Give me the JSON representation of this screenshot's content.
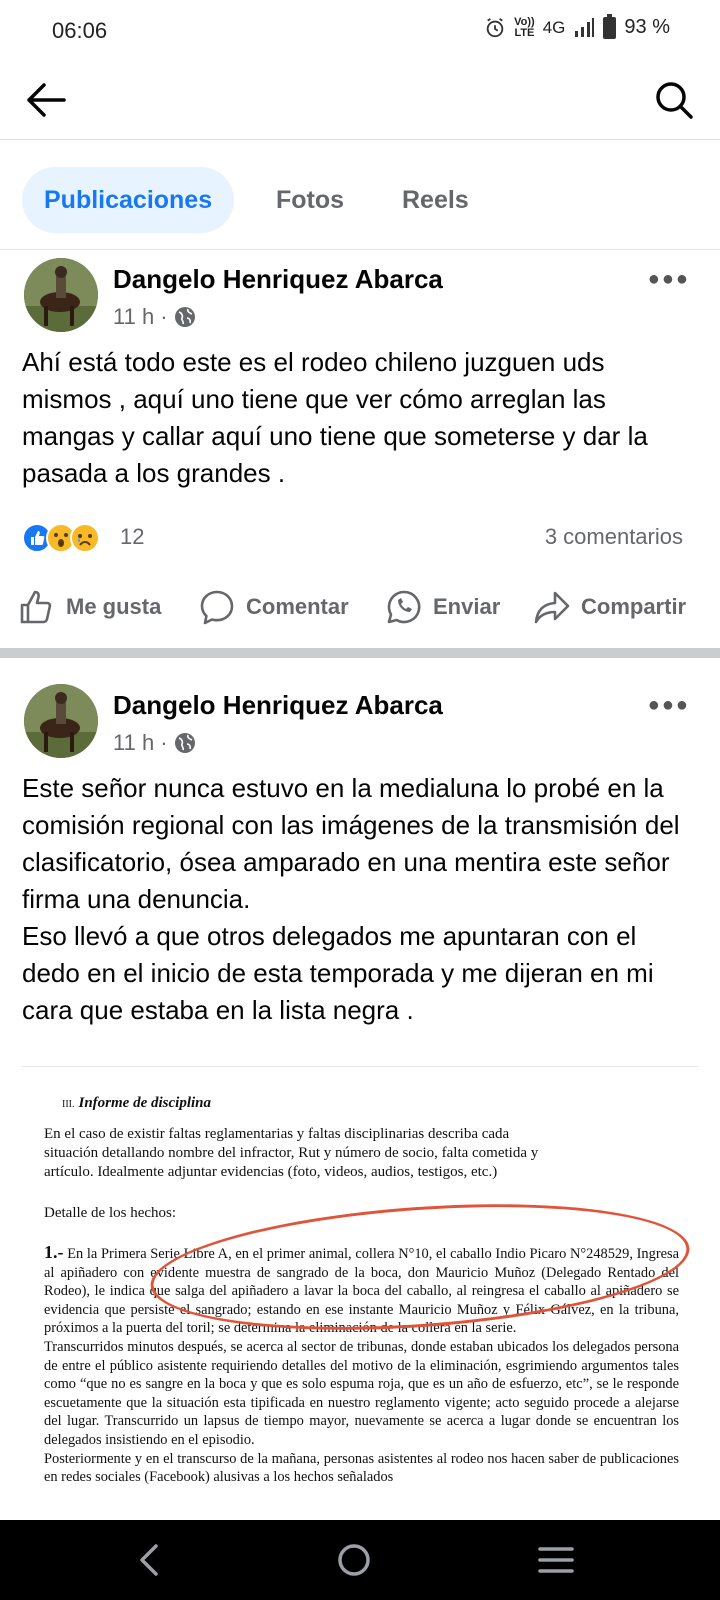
{
  "status_bar": {
    "time": "06:06",
    "network_label_top": "Vo))",
    "network_label_bottom": "LTE",
    "network_type": "4G",
    "battery": "93 %"
  },
  "app_bar": {
    "back_icon": "arrow-left-icon",
    "search_icon": "search-icon"
  },
  "tabs": [
    {
      "label": "Publicaciones",
      "active": true
    },
    {
      "label": "Fotos",
      "active": false
    },
    {
      "label": "Reels",
      "active": false
    }
  ],
  "posts": [
    {
      "author": "Dangelo Henriquez Abarca",
      "time": "11 h",
      "privacy_separator": "·",
      "text": "Ahí está todo este es el rodeo chileno juzguen uds mismos , aquí uno tiene que ver cómo arreglan las mangas y callar aquí uno tiene que someterse y dar la pasada a los grandes .",
      "reaction_count": "12",
      "comments": "3 comentarios"
    },
    {
      "author": "Dangelo Henriquez Abarca",
      "time": "11 h",
      "privacy_separator": "·",
      "text": "Este señor nunca estuvo en la medialuna lo probé en la comisión regional con las imágenes de la transmisión del clasificatorio, ósea amparado en una mentira este señor firma una denuncia.\nEso llevó a que otros delegados me apuntaran con el dedo en el inicio de esta temporada y me dijeran en mi cara que estaba en la lista negra ."
    }
  ],
  "actions": {
    "like": "Me gusta",
    "comment": "Comentar",
    "send": "Enviar",
    "share": "Compartir"
  },
  "document": {
    "section_number": "III.",
    "section_title": "Informe de disciplina",
    "intro": "En el caso de existir faltas reglamentarias y faltas disciplinarias describa cada situación detallando nombre del infractor, Rut y número de socio, falta cometida y artículo. Idealmente adjuntar evidencias (foto, videos, audios, testigos, etc.)",
    "detail_heading": "Detalle de los hechos:",
    "item_number": "1.-",
    "paragraph_1": "En la Primera Serie Libre A, en el primer animal, collera N°10, el caballo Indio Picaro N°248529, Ingresa al apiñadero con evidente muestra de sangrado de la boca, don Mauricio Muñoz (Delegado Rentado del Rodeo), le indica que salga del apiñadero a lavar la boca del caballo, al reingresa el caballo al apiñadero se evidencia que persiste el sangrado; estando en ese instante Mauricio Muñoz y Félix Gálvez, en la tribuna, próximos a la puerta del toril; se determina la eliminación de la collera en la serie.",
    "paragraph_2": "Transcurridos minutos después, se acerca al sector de tribunas, donde estaban ubicados los delegados persona de entre el público asistente requiriendo detalles del motivo de la eliminación, esgrimiendo argumentos tales como “que no es sangre en la boca y que es solo espuma roja, que es un año de esfuerzo, etc”, se le responde escuetamente que la situación esta tipificada en nuestro reglamento vigente; acto seguido procede a alejarse del lugar. Transcurrido un lapsus de tiempo mayor, nuevamente se acerca a lugar donde se encuentran los delegados insistiendo en el episodio.",
    "paragraph_3": "Posteriormente y en el transcurso de la mañana, personas asistentes al rodeo nos hacen saber de publicaciones en redes sociales (Facebook) alusivas a los hechos señalados"
  },
  "colors": {
    "accent": "#1877f2",
    "tab_active_bg": "#e7f3ff",
    "secondary_text": "#65676b",
    "annotation_circle": "#e0553a"
  }
}
